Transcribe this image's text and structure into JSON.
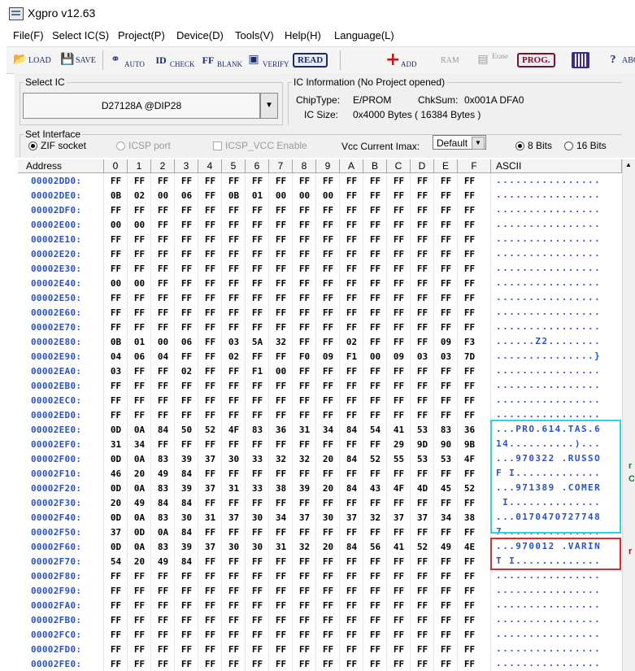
{
  "window": {
    "title": "Xgpro v12.63"
  },
  "menu": [
    "File(F)",
    "Select IC(S)",
    "Project(P)",
    "Device(D)",
    "Tools(V)",
    "Help(H)",
    "Language(L)"
  ],
  "toolbar": {
    "load": "LOAD",
    "save": "SAVE",
    "auto": "AUTO",
    "check": "CHECK",
    "blank": "BLANK",
    "verify": "VERIFY",
    "read": "READ",
    "add": "ADD",
    "ram": "RAM",
    "erase": "Erase",
    "prog": "PROG.",
    "about": "ABOU"
  },
  "select_ic": {
    "legend": "Select IC",
    "value": "D27128A @DIP28"
  },
  "ic_info": {
    "legend": "IC Information (No Project opened)",
    "chip_type_label": "ChipType:",
    "chip_type": "E/PROM",
    "chksum_label": "ChkSum:",
    "chksum": "0x001A DFA0",
    "ic_size_label": "IC Size:",
    "ic_size": "0x4000 Bytes ( 16384 Bytes )"
  },
  "interface": {
    "legend": "Set Interface",
    "zif": "ZIF socket",
    "icsp": "ICSP port",
    "icsp_vcc": "ICSP_VCC Enable",
    "vcc_label": "Vcc Current Imax:",
    "vcc_value": "Default",
    "bits8": "8 Bits",
    "bits16": "16 Bits"
  },
  "grid": {
    "headers": [
      "Address",
      "0",
      "1",
      "2",
      "3",
      "4",
      "5",
      "6",
      "7",
      "8",
      "9",
      "A",
      "B",
      "C",
      "D",
      "E",
      "F",
      "ASCII"
    ],
    "rows": [
      [
        "00002DD0:",
        "FF FF FF FF FF FF FF FF FF FF FF FF FF FF FF FF",
        "................"
      ],
      [
        "00002DE0:",
        "0B 02 00 06 FF 0B 01 00 00 00 FF FF FF FF FF FF",
        "................"
      ],
      [
        "00002DF0:",
        "FF FF FF FF FF FF FF FF FF FF FF FF FF FF FF FF",
        "................"
      ],
      [
        "00002E00:",
        "00 00 FF FF FF FF FF FF FF FF FF FF FF FF FF FF",
        "................"
      ],
      [
        "00002E10:",
        "FF FF FF FF FF FF FF FF FF FF FF FF FF FF FF FF",
        "................"
      ],
      [
        "00002E20:",
        "FF FF FF FF FF FF FF FF FF FF FF FF FF FF FF FF",
        "................"
      ],
      [
        "00002E30:",
        "FF FF FF FF FF FF FF FF FF FF FF FF FF FF FF FF",
        "................"
      ],
      [
        "00002E40:",
        "00 00 FF FF FF FF FF FF FF FF FF FF FF FF FF FF",
        "................"
      ],
      [
        "00002E50:",
        "FF FF FF FF FF FF FF FF FF FF FF FF FF FF FF FF",
        "................"
      ],
      [
        "00002E60:",
        "FF FF FF FF FF FF FF FF FF FF FF FF FF FF FF FF",
        "................"
      ],
      [
        "00002E70:",
        "FF FF FF FF FF FF FF FF FF FF FF FF FF FF FF FF",
        "................"
      ],
      [
        "00002E80:",
        "0B 01 00 06 FF 03 5A 32 FF FF 02 FF FF FF 09 F3",
        "......Z2........"
      ],
      [
        "00002E90:",
        "04 06 04 FF FF 02 FF FF F0 09 F1 00 09 03 03 7D",
        "...............}"
      ],
      [
        "00002EA0:",
        "03 FF FF 02 FF FF F1 00 FF FF FF FF FF FF FF FF",
        "................"
      ],
      [
        "00002EB0:",
        "FF FF FF FF FF FF FF FF FF FF FF FF FF FF FF FF",
        "................"
      ],
      [
        "00002EC0:",
        "FF FF FF FF FF FF FF FF FF FF FF FF FF FF FF FF",
        "................"
      ],
      [
        "00002ED0:",
        "FF FF FF FF FF FF FF FF FF FF FF FF FF FF FF FF",
        "................"
      ],
      [
        "00002EE0:",
        "0D 0A 84 50 52 4F 83 36 31 34 84 54 41 53 83 36",
        "...PRO.614.TAS.6"
      ],
      [
        "00002EF0:",
        "31 34 FF FF FF FF FF FF FF FF FF FF 29 9D 90 9B",
        "14..........)..."
      ],
      [
        "00002F00:",
        "0D 0A 83 39 37 30 33 32 32 20 84 52 55 53 53 4F",
        "...970322 .RUSSO"
      ],
      [
        "00002F10:",
        "46 20 49 84 FF FF FF FF FF FF FF FF FF FF FF FF",
        "F I............."
      ],
      [
        "00002F20:",
        "0D 0A 83 39 37 31 33 38 39 20 84 43 4F 4D 45 52",
        "...971389 .COMER"
      ],
      [
        "00002F30:",
        "20 49 84 84 FF FF FF FF FF FF FF FF FF FF FF FF",
        " I.............."
      ],
      [
        "00002F40:",
        "0D 0A 83 30 31 37 30 34 37 30 37 32 37 37 34 38",
        "...0170470727748"
      ],
      [
        "00002F50:",
        "37 0D 0A 84 FF FF FF FF FF FF FF FF FF FF FF FF",
        "7..............."
      ],
      [
        "00002F60:",
        "0D 0A 83 39 37 30 30 31 32 20 84 56 41 52 49 4E",
        "...970012 .VARIN"
      ],
      [
        "00002F70:",
        "54 20 49 84 FF FF FF FF FF FF FF FF FF FF FF FF",
        "T I............."
      ],
      [
        "00002F80:",
        "FF FF FF FF FF FF FF FF FF FF FF FF FF FF FF FF",
        "................"
      ],
      [
        "00002F90:",
        "FF FF FF FF FF FF FF FF FF FF FF FF FF FF FF FF",
        "................"
      ],
      [
        "00002FA0:",
        "FF FF FF FF FF FF FF FF FF FF FF FF FF FF FF FF",
        "................"
      ],
      [
        "00002FB0:",
        "FF FF FF FF FF FF FF FF FF FF FF FF FF FF FF FF",
        "................"
      ],
      [
        "00002FC0:",
        "FF FF FF FF FF FF FF FF FF FF FF FF FF FF FF FF",
        "................"
      ],
      [
        "00002FD0:",
        "FF FF FF FF FF FF FF FF FF FF FF FF FF FF FF FF",
        "................"
      ],
      [
        "00002FE0:",
        "FF FF FF FF FF FF FF FF FF FF FF FF FF FF FF FF",
        "................"
      ]
    ]
  },
  "colors": {
    "address": "#2a51c5",
    "ascii": "#2a51c5",
    "highlight_cyan": "#2fd1e8",
    "highlight_red": "#e02828"
  },
  "side_marks": [
    "r",
    "C",
    "r"
  ]
}
